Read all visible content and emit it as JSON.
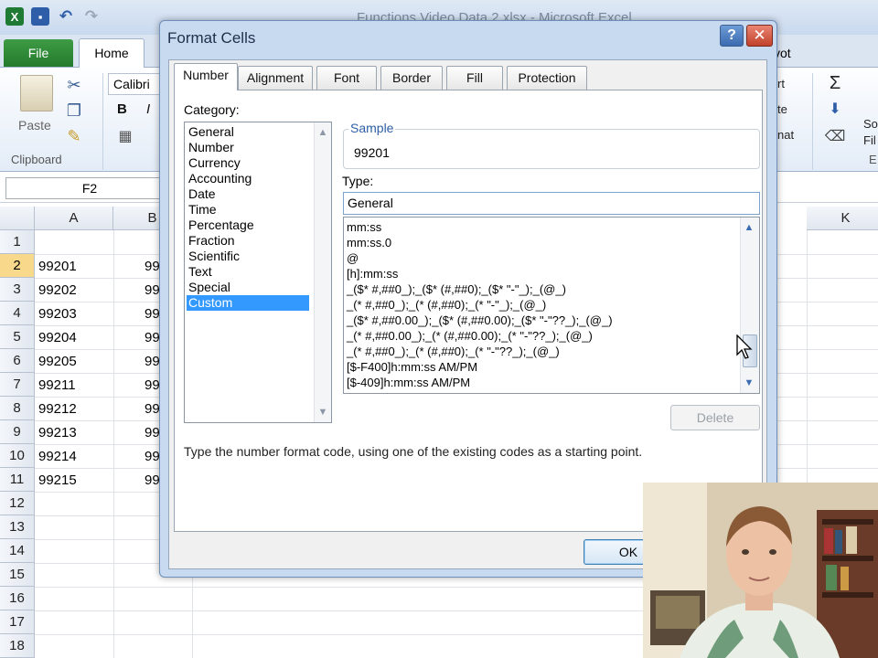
{
  "window": {
    "title": "Functions Video Data 2.xlsx - Microsoft Excel"
  },
  "ribbon": {
    "tabs": {
      "file": "File",
      "home": "Home",
      "pivot": "vot"
    },
    "clipboard": {
      "paste_label": "Paste",
      "group_label": "Clipboard"
    },
    "font": {
      "font_name": "Calibri",
      "bold_label": "B",
      "italic_label": "I"
    },
    "right_fragments": {
      "sort": "rt",
      "delete": "te",
      "format": "nat",
      "sort_filter": "So",
      "filter": "Fil",
      "editing": "E"
    }
  },
  "namebox": {
    "value": "F2"
  },
  "grid": {
    "columns": [
      "A",
      "B",
      "K"
    ],
    "rows": [
      "1",
      "2",
      "3",
      "4",
      "5",
      "6",
      "7",
      "8",
      "9",
      "10",
      "11",
      "12",
      "13",
      "14",
      "15",
      "16",
      "17",
      "18"
    ],
    "active_row": "2",
    "col_a_values": [
      "",
      "99201",
      "99202",
      "99203",
      "99204",
      "99205",
      "99211",
      "99212",
      "99213",
      "99214",
      "99215"
    ],
    "col_b_values": [
      "",
      "99",
      "99",
      "99",
      "99",
      "99",
      "99",
      "99",
      "99",
      "99",
      "99"
    ]
  },
  "dialog": {
    "title": "Format Cells",
    "help_label": "?",
    "close_label": "✕",
    "tabs": [
      "Number",
      "Alignment",
      "Font",
      "Border",
      "Fill",
      "Protection"
    ],
    "active_tab": "Number",
    "category": {
      "label": "Category:",
      "items": [
        "General",
        "Number",
        "Currency",
        "Accounting",
        "Date",
        "Time",
        "Percentage",
        "Fraction",
        "Scientific",
        "Text",
        "Special",
        "Custom"
      ],
      "selected": "Custom"
    },
    "sample": {
      "label": "Sample",
      "value": "99201"
    },
    "type": {
      "label": "Type:",
      "value": "General",
      "formats": [
        "mm:ss",
        "mm:ss.0",
        "@",
        "[h]:mm:ss",
        "_($* #,##0_);_($* (#,##0);_($* \"-\"_);_(@_)",
        "_(* #,##0_);_(* (#,##0);_(* \"-\"_);_(@_)",
        "_($* #,##0.00_);_($* (#,##0.00);_($* \"-\"??_);_(@_)",
        "_(* #,##0.00_);_(* (#,##0.00);_(* \"-\"??_);_(@_)",
        "_(* #,##0_);_(* (#,##0);_(* \"-\"??_);_(@_)",
        "[$-F400]h:mm:ss AM/PM",
        "[$-409]h:mm:ss AM/PM"
      ]
    },
    "delete_label": "Delete",
    "hint": "Type the number format code, using one of the existing codes as a starting point.",
    "ok_label": "OK"
  },
  "colors": {
    "file_tab": "#237b2b",
    "selection": "#3399ff",
    "close_button": "#c1412b",
    "active_row_header": "#f8d98c"
  },
  "icons": [
    "excel-logo-icon",
    "save-icon",
    "undo-icon",
    "redo-icon",
    "paste-icon",
    "cut-icon",
    "copy-icon",
    "format-painter-icon",
    "sum-icon",
    "fill-icon",
    "clear-icon",
    "mouse-cursor-icon"
  ]
}
